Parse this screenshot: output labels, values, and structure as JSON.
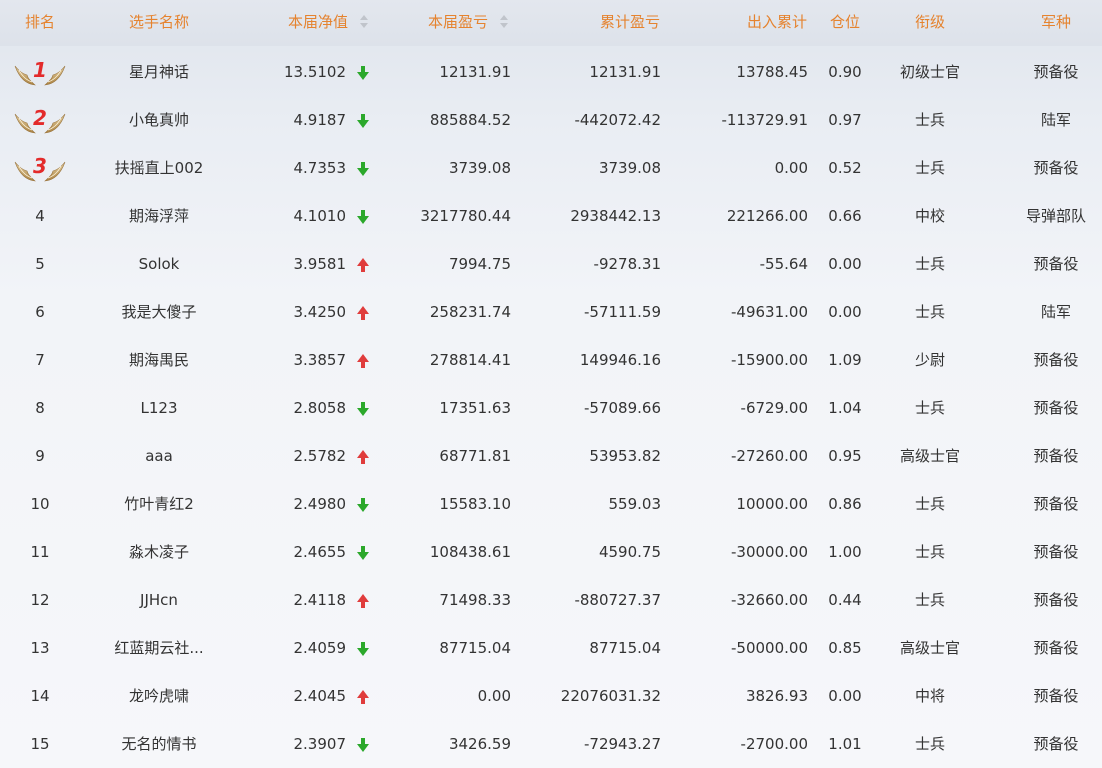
{
  "header": {
    "rank": "排名",
    "name": "选手名称",
    "nav": "本届净值",
    "pnl": "本届盈亏",
    "cum_pnl": "累计盈亏",
    "cash_flow": "出入累计",
    "position": "仓位",
    "rank_title": "衔级",
    "branch": "军种"
  },
  "colors": {
    "header_text": "#e5832f",
    "up": "#e03c3c",
    "down": "#2ba82b",
    "medal_number": "#e32b2b"
  },
  "rows": [
    {
      "rank": "1",
      "medal": "medal-icon",
      "name": "星月神话",
      "nav": "13.5102",
      "trend": "down",
      "pnl": "12131.91",
      "cum_pnl": "12131.91",
      "cash_flow": "13788.45",
      "position": "0.90",
      "rank_title": "初级士官",
      "branch": "预备役"
    },
    {
      "rank": "2",
      "medal": "medal-icon",
      "name": "小龟真帅",
      "nav": "4.9187",
      "trend": "down",
      "pnl": "885884.52",
      "cum_pnl": "-442072.42",
      "cash_flow": "-113729.91",
      "position": "0.97",
      "rank_title": "士兵",
      "branch": "陆军"
    },
    {
      "rank": "3",
      "medal": "medal-icon",
      "name": "扶摇直上002",
      "nav": "4.7353",
      "trend": "down",
      "pnl": "3739.08",
      "cum_pnl": "3739.08",
      "cash_flow": "0.00",
      "position": "0.52",
      "rank_title": "士兵",
      "branch": "预备役"
    },
    {
      "rank": "4",
      "name": "期海浮萍",
      "nav": "4.1010",
      "trend": "down",
      "pnl": "3217780.44",
      "cum_pnl": "2938442.13",
      "cash_flow": "221266.00",
      "position": "0.66",
      "rank_title": "中校",
      "branch": "导弹部队"
    },
    {
      "rank": "5",
      "name": "Solok",
      "nav": "3.9581",
      "trend": "up",
      "pnl": "7994.75",
      "cum_pnl": "-9278.31",
      "cash_flow": "-55.64",
      "position": "0.00",
      "rank_title": "士兵",
      "branch": "预备役"
    },
    {
      "rank": "6",
      "name": "我是大傻子",
      "nav": "3.4250",
      "trend": "up",
      "pnl": "258231.74",
      "cum_pnl": "-57111.59",
      "cash_flow": "-49631.00",
      "position": "0.00",
      "rank_title": "士兵",
      "branch": "陆军"
    },
    {
      "rank": "7",
      "name": "期海禺民",
      "nav": "3.3857",
      "trend": "up",
      "pnl": "278814.41",
      "cum_pnl": "149946.16",
      "cash_flow": "-15900.00",
      "position": "1.09",
      "rank_title": "少尉",
      "branch": "预备役"
    },
    {
      "rank": "8",
      "name": "L123",
      "nav": "2.8058",
      "trend": "down",
      "pnl": "17351.63",
      "cum_pnl": "-57089.66",
      "cash_flow": "-6729.00",
      "position": "1.04",
      "rank_title": "士兵",
      "branch": "预备役"
    },
    {
      "rank": "9",
      "name": "aaa",
      "nav": "2.5782",
      "trend": "up",
      "pnl": "68771.81",
      "cum_pnl": "53953.82",
      "cash_flow": "-27260.00",
      "position": "0.95",
      "rank_title": "高级士官",
      "branch": "预备役"
    },
    {
      "rank": "10",
      "name": "竹叶青红2",
      "nav": "2.4980",
      "trend": "down",
      "pnl": "15583.10",
      "cum_pnl": "559.03",
      "cash_flow": "10000.00",
      "position": "0.86",
      "rank_title": "士兵",
      "branch": "预备役"
    },
    {
      "rank": "11",
      "name": "淼木凌子",
      "nav": "2.4655",
      "trend": "down",
      "pnl": "108438.61",
      "cum_pnl": "4590.75",
      "cash_flow": "-30000.00",
      "position": "1.00",
      "rank_title": "士兵",
      "branch": "预备役"
    },
    {
      "rank": "12",
      "name": "JJHcn",
      "nav": "2.4118",
      "trend": "up",
      "pnl": "71498.33",
      "cum_pnl": "-880727.37",
      "cash_flow": "-32660.00",
      "position": "0.44",
      "rank_title": "士兵",
      "branch": "预备役"
    },
    {
      "rank": "13",
      "name": "红蓝期云社...",
      "nav": "2.4059",
      "trend": "down",
      "pnl": "87715.04",
      "cum_pnl": "87715.04",
      "cash_flow": "-50000.00",
      "position": "0.85",
      "rank_title": "高级士官",
      "branch": "预备役"
    },
    {
      "rank": "14",
      "name": "龙吟虎啸",
      "nav": "2.4045",
      "trend": "up",
      "pnl": "0.00",
      "cum_pnl": "22076031.32",
      "cash_flow": "3826.93",
      "position": "0.00",
      "rank_title": "中将",
      "branch": "预备役"
    },
    {
      "rank": "15",
      "name": "无名的情书",
      "nav": "2.3907",
      "trend": "down",
      "pnl": "3426.59",
      "cum_pnl": "-72943.27",
      "cash_flow": "-2700.00",
      "position": "1.01",
      "rank_title": "士兵",
      "branch": "预备役"
    }
  ]
}
